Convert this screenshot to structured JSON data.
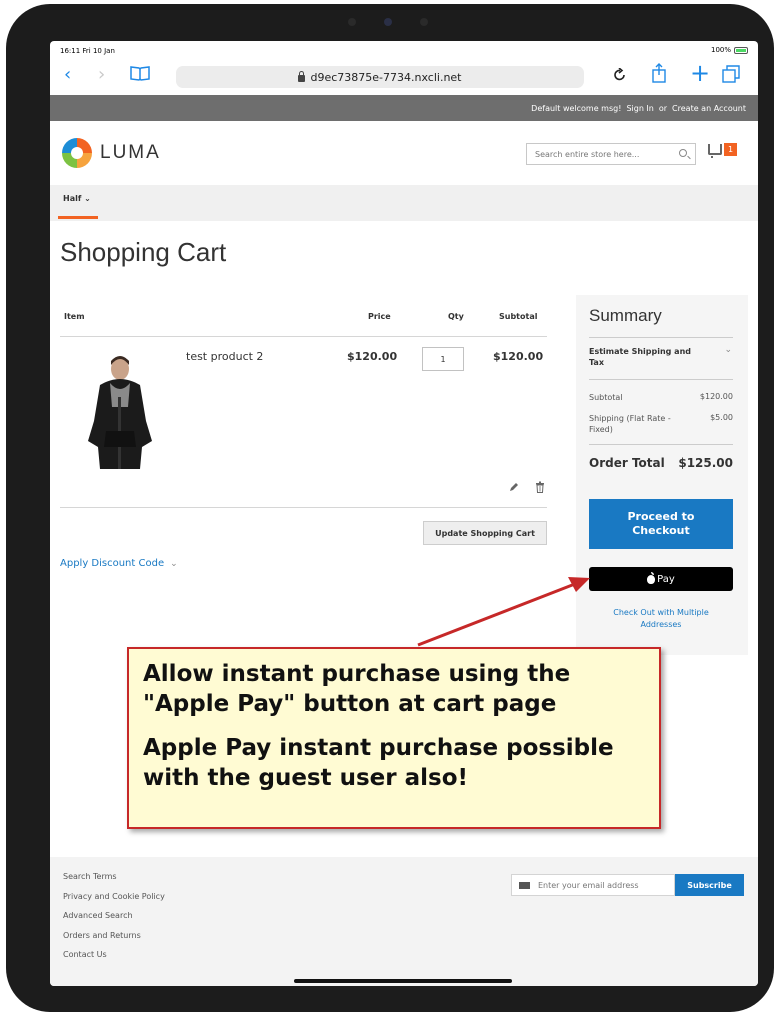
{
  "status": {
    "time": "16:11  Fri 10 Jan",
    "battery": "100%"
  },
  "browser": {
    "url": "d9ec73875e-7734.nxcli.net"
  },
  "top_links": {
    "welcome": "Default welcome msg!",
    "sign_in": "Sign In",
    "or": "or",
    "create_account": "Create an Account"
  },
  "header": {
    "logo": "LUMA",
    "search_placeholder": "Search entire store here...",
    "cart_count": "1"
  },
  "nav": {
    "item": "Half"
  },
  "page": {
    "title": "Shopping Cart"
  },
  "cart": {
    "headers": {
      "item": "Item",
      "price": "Price",
      "qty": "Qty",
      "subtotal": "Subtotal"
    },
    "item": {
      "name": "test product 2",
      "price": "$120.00",
      "qty": "1",
      "subtotal": "$120.00"
    },
    "update_button": "Update Shopping Cart",
    "discount": "Apply Discount Code"
  },
  "summary": {
    "title": "Summary",
    "estimate": "Estimate Shipping and Tax",
    "subtotal_label": "Subtotal",
    "subtotal_value": "$120.00",
    "shipping_label": "Shipping (Flat Rate - Fixed)",
    "shipping_value": "$5.00",
    "total_label": "Order Total",
    "total_value": "$125.00",
    "checkout_button": "Proceed to Checkout",
    "applepay_label": "Pay",
    "multi_address": "Check Out with Multiple Addresses"
  },
  "callout": {
    "line1": "Allow instant purchase using the \"Apple Pay\" button at cart page",
    "line2": "Apple Pay instant purchase possible with the guest user also!"
  },
  "footer": {
    "links": [
      "Search Terms",
      "Privacy and Cookie Policy",
      "Advanced Search",
      "Orders and Returns",
      "Contact Us"
    ],
    "newsletter_placeholder": "Enter your email address",
    "subscribe": "Subscribe"
  },
  "colors": {
    "accent": "#1979c3",
    "brand": "#f26322",
    "callout_border": "#c62828",
    "callout_bg": "#fffbd3"
  }
}
